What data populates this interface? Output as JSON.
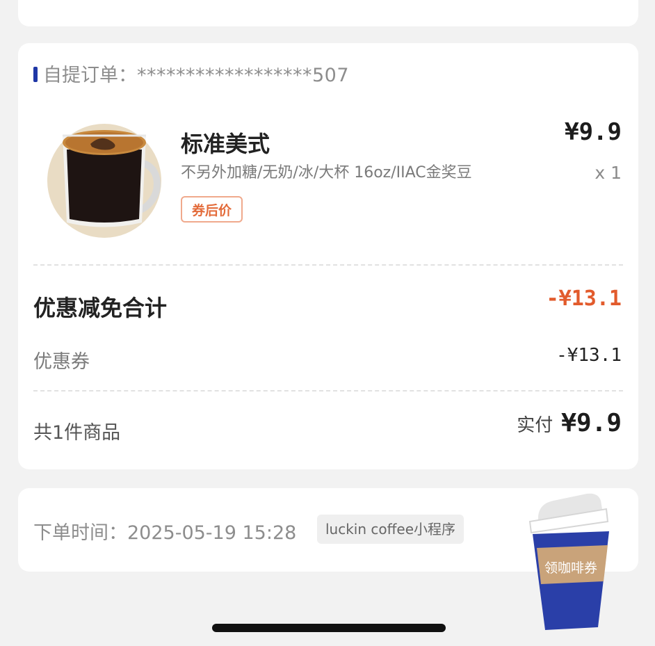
{
  "order": {
    "label_prefix": "自提订单：",
    "number": "******************507"
  },
  "product": {
    "name": "标准美式",
    "specs": "不另外加糖/无奶/冰/大杯 16oz/IIAC金奖豆",
    "tag": "券后价",
    "price": "¥9.9",
    "quantity": "x 1",
    "image_icon": "coffee-mug-icon"
  },
  "discount": {
    "title": "优惠减免合计",
    "total": "-¥13.1",
    "coupon_label": "优惠券",
    "coupon_value": "-¥13.1",
    "total_color": "#e25b2c"
  },
  "summary": {
    "item_count": "共1件商品",
    "paid_label": "实付",
    "paid_value": "¥9.9"
  },
  "order_time": {
    "label": "下单时间：2025-05-19 15:28",
    "source": "luckin coffee小程序"
  },
  "promo": {
    "cup_text": "领咖啡券",
    "cup_color": "#2a3fa8",
    "icon": "coffee-cup-icon"
  },
  "colors": {
    "accent": "#1f37a6",
    "tag_border": "#f0a98c",
    "tag_text": "#e36b3a"
  }
}
